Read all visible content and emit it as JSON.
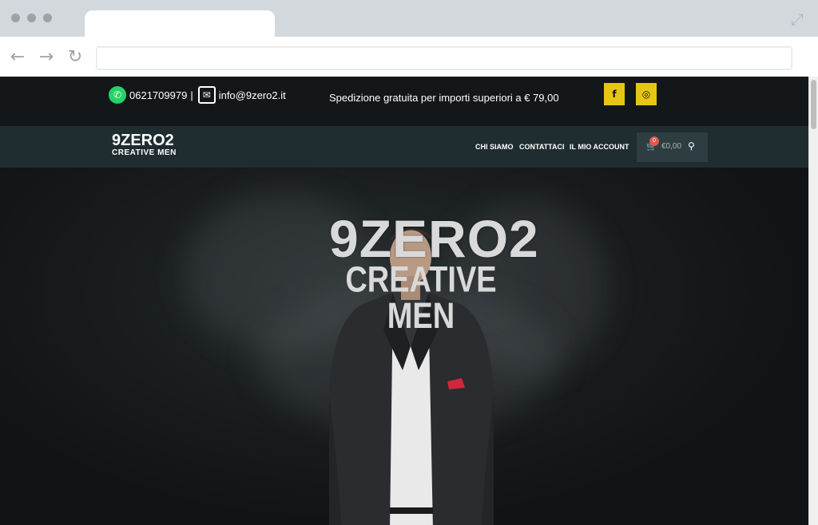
{
  "browser": {
    "url": "",
    "nav": {
      "back_icon": "back-arrow-icon",
      "forward_icon": "forward-arrow-icon",
      "reload_icon": "reload-icon"
    }
  },
  "topbar": {
    "phone": "0621709979",
    "separator": "|",
    "email": "info@9zero2.it",
    "shipping": "Spedizione gratuita per importi superiori a € 79,00",
    "social": [
      {
        "name": "facebook",
        "glyph": "f"
      },
      {
        "name": "instagram",
        "glyph": "◎"
      }
    ],
    "accent": "#e6c614"
  },
  "navbar": {
    "logo_top": "9ZERO2",
    "logo_bottom": "CREATIVE MEN",
    "menu": [
      "CHI SIAMO",
      "CONTATTACI",
      "IL MIO ACCOUNT"
    ],
    "cart_count": "0",
    "cart_total": "€0,00"
  },
  "hero": {
    "title": "9ZERO2",
    "subtitle": "CREATIVE MEN"
  }
}
